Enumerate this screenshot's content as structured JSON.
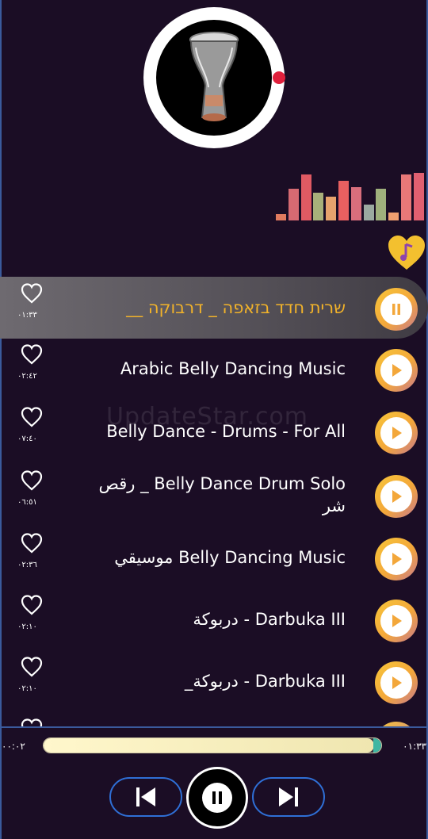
{
  "player": {
    "album_icon": "darbuka-drum-image",
    "fav_icon": "heart-music-note-icon",
    "equalizer_colors": [
      "#e07a5f",
      "#d66a72",
      "#e05a63",
      "#a8b07a",
      "#e7a36d",
      "#e86060",
      "#d86e7c",
      "#9ba9a0",
      "#9fb07c",
      "#f0a070",
      "#e87878",
      "#e06070"
    ]
  },
  "tracks": [
    {
      "title": "__ שרית חדד בזאפה _ דרבוקה",
      "duration": "٠١:٣٣",
      "active": true
    },
    {
      "title": "Arabic Belly Dancing Music",
      "duration": "٠٢:٤٢"
    },
    {
      "title": "Belly Dance - Drums - For All",
      "duration": "٠٧:٤٠"
    },
    {
      "title": "رقص _ Belly Dance Drum Solo شر",
      "duration": "٠٦:٥١"
    },
    {
      "title": "موسيقي    Belly Dancing Music",
      "duration": "٠٢:٣٦"
    },
    {
      "title": "دربوكة - Darbuka III",
      "duration": "٠٢:١٠"
    },
    {
      "title": "_دربوكة - Darbuka III",
      "duration": "٠٢:١٠"
    }
  ],
  "watermark": "UpdateStar.com",
  "progress": {
    "elapsed": "٠٠:٠٢",
    "total": "٠١:٣٣",
    "fraction": 0.98
  },
  "controls": {
    "prev_icon": "skip-previous-icon",
    "pause_icon": "pause-icon",
    "next_icon": "skip-next-icon"
  }
}
